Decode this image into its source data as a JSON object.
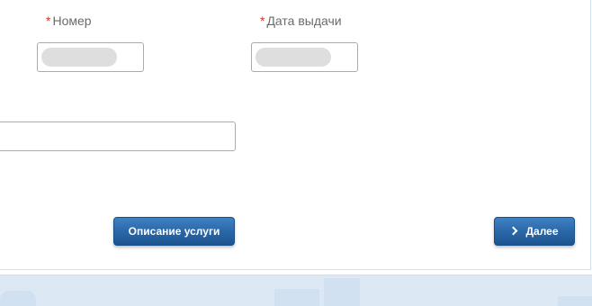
{
  "form": {
    "number_field": {
      "required_mark": "*",
      "label": "Номер"
    },
    "issue_date_field": {
      "required_mark": "*",
      "label": "Дата выдачи"
    },
    "issued_by_field": {
      "value": ""
    }
  },
  "actions": {
    "service_description_label": "Описание услуги",
    "next_label": "Далее",
    "next_icon": "chevron-right-icon"
  },
  "colors": {
    "required_mark": "#d0342c",
    "button_primary": "#2a67a8",
    "input_border": "#8fb3c9",
    "footer_background": "#dce9f5"
  }
}
